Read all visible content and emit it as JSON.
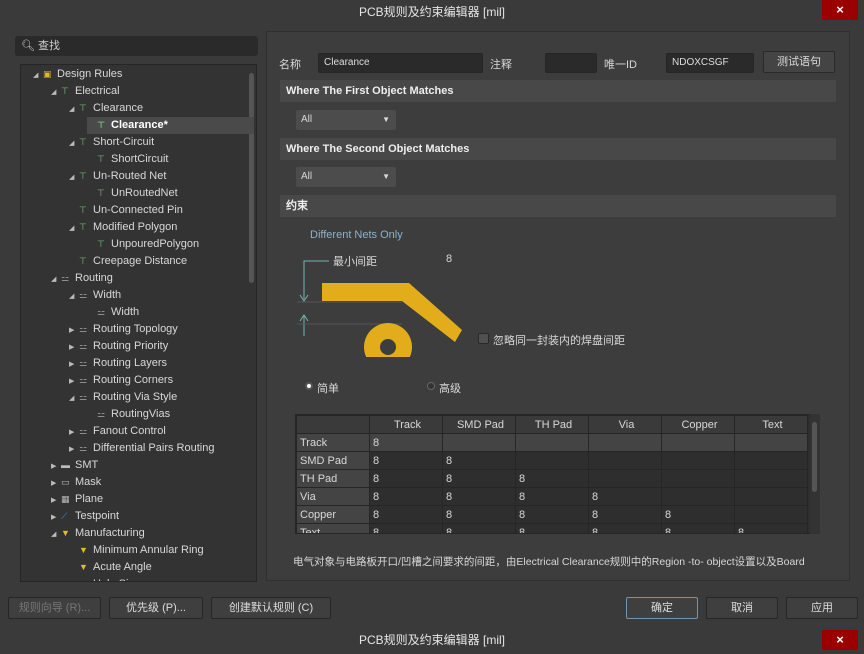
{
  "window": {
    "title": "PCB规则及约束编辑器 [mil]",
    "close": "×",
    "footer_title": "PCB规则及约束编辑器 [mil]"
  },
  "search": {
    "placeholder": "查找"
  },
  "tree": [
    {
      "label": "Design Rules",
      "level": 0,
      "expanded": true,
      "icon": "folder-icon"
    },
    {
      "label": "Electrical",
      "level": 1,
      "expanded": true,
      "icon": "electrical-rule-icon"
    },
    {
      "label": "Clearance",
      "level": 2,
      "expanded": true,
      "icon": "electrical-rule-icon"
    },
    {
      "label": "Clearance*",
      "level": 3,
      "selected": true,
      "icon": "electrical-rule-icon"
    },
    {
      "label": "Short-Circuit",
      "level": 2,
      "expanded": true,
      "icon": "electrical-rule-icon"
    },
    {
      "label": "ShortCircuit",
      "level": 3,
      "icon": "electrical-rule-icon"
    },
    {
      "label": "Un-Routed Net",
      "level": 2,
      "expanded": true,
      "icon": "electrical-rule-icon"
    },
    {
      "label": "UnRoutedNet",
      "level": 3,
      "icon": "electrical-rule-icon"
    },
    {
      "label": "Un-Connected Pin",
      "level": 2,
      "icon": "electrical-rule-icon"
    },
    {
      "label": "Modified Polygon",
      "level": 2,
      "expanded": true,
      "icon": "electrical-rule-icon"
    },
    {
      "label": "UnpouredPolygon",
      "level": 3,
      "icon": "electrical-rule-icon"
    },
    {
      "label": "Creepage Distance",
      "level": 2,
      "icon": "electrical-rule-icon"
    },
    {
      "label": "Routing",
      "level": 1,
      "expanded": true,
      "icon": "routing-icon"
    },
    {
      "label": "Width",
      "level": 2,
      "expanded": true,
      "icon": "routing-icon"
    },
    {
      "label": "Width",
      "level": 3,
      "icon": "routing-icon"
    },
    {
      "label": "Routing Topology",
      "level": 2,
      "expanded": false,
      "icon": "routing-icon"
    },
    {
      "label": "Routing Priority",
      "level": 2,
      "expanded": false,
      "icon": "routing-icon"
    },
    {
      "label": "Routing Layers",
      "level": 2,
      "expanded": false,
      "icon": "routing-icon"
    },
    {
      "label": "Routing Corners",
      "level": 2,
      "expanded": false,
      "icon": "routing-icon"
    },
    {
      "label": "Routing Via Style",
      "level": 2,
      "expanded": true,
      "icon": "routing-icon"
    },
    {
      "label": "RoutingVias",
      "level": 3,
      "icon": "routing-icon"
    },
    {
      "label": "Fanout Control",
      "level": 2,
      "expanded": false,
      "icon": "routing-icon"
    },
    {
      "label": "Differential Pairs Routing",
      "level": 2,
      "expanded": false,
      "icon": "routing-icon"
    },
    {
      "label": "SMT",
      "level": 1,
      "expanded": false,
      "icon": "smt-icon"
    },
    {
      "label": "Mask",
      "level": 1,
      "expanded": false,
      "icon": "mask-icon"
    },
    {
      "label": "Plane",
      "level": 1,
      "expanded": false,
      "icon": "plane-icon"
    },
    {
      "label": "Testpoint",
      "level": 1,
      "expanded": false,
      "icon": "testpoint-icon"
    },
    {
      "label": "Manufacturing",
      "level": 1,
      "expanded": true,
      "icon": "manufacturing-icon"
    },
    {
      "label": "Minimum Annular Ring",
      "level": 2,
      "icon": "manufacturing-icon"
    },
    {
      "label": "Acute Angle",
      "level": 2,
      "icon": "manufacturing-icon"
    },
    {
      "label": "Hole Size",
      "level": 2,
      "icon": "manufacturing-icon"
    }
  ],
  "rule": {
    "name_label": "名称",
    "name": "Clearance",
    "comment_label": "注释",
    "comment": "",
    "id_label": "唯一ID",
    "id": "NDOXCSGF",
    "test_button": "测试语句"
  },
  "first": {
    "header": "Where The First Object Matches",
    "value": "All"
  },
  "second": {
    "header": "Where The Second Object Matches",
    "value": "All"
  },
  "constraints": {
    "header": "约束",
    "net_scope": "Different Nets Only",
    "min_clearance_label": "最小间距",
    "min_clearance": "8",
    "ignore_pads_label": "忽略同一封装内的焊盘间距",
    "ignore_pads_checked": false,
    "mode_simple": "简单",
    "mode_advanced": "高级",
    "mode_selected": "simple",
    "colors": {
      "copper": "#e2ac1b"
    }
  },
  "grid": {
    "columns": [
      "Track",
      "SMD Pad",
      "TH Pad",
      "Via",
      "Copper",
      "Text"
    ],
    "rows": [
      {
        "label": "Track",
        "values": [
          "8",
          "",
          "",
          "",
          "",
          ""
        ]
      },
      {
        "label": "SMD Pad",
        "values": [
          "8",
          "8",
          "",
          "",
          "",
          ""
        ]
      },
      {
        "label": "TH Pad",
        "values": [
          "8",
          "8",
          "8",
          "",
          "",
          ""
        ]
      },
      {
        "label": "Via",
        "values": [
          "8",
          "8",
          "8",
          "8",
          "",
          ""
        ]
      },
      {
        "label": "Copper",
        "values": [
          "8",
          "8",
          "8",
          "8",
          "8",
          ""
        ]
      },
      {
        "label": "Text",
        "values": [
          "8",
          "8",
          "8",
          "8",
          "8",
          "8"
        ]
      }
    ]
  },
  "description": "电气对象与电路板开口/凹槽之间要求的间距，由Electrical Clearance规则中的Region -to- object设置以及Board",
  "buttons": {
    "wizard": "规则向导 (R)...",
    "priority": "优先级 (P)...",
    "create_default": "创建默认规则 (C)",
    "ok": "确定",
    "cancel": "取消",
    "apply": "应用"
  }
}
